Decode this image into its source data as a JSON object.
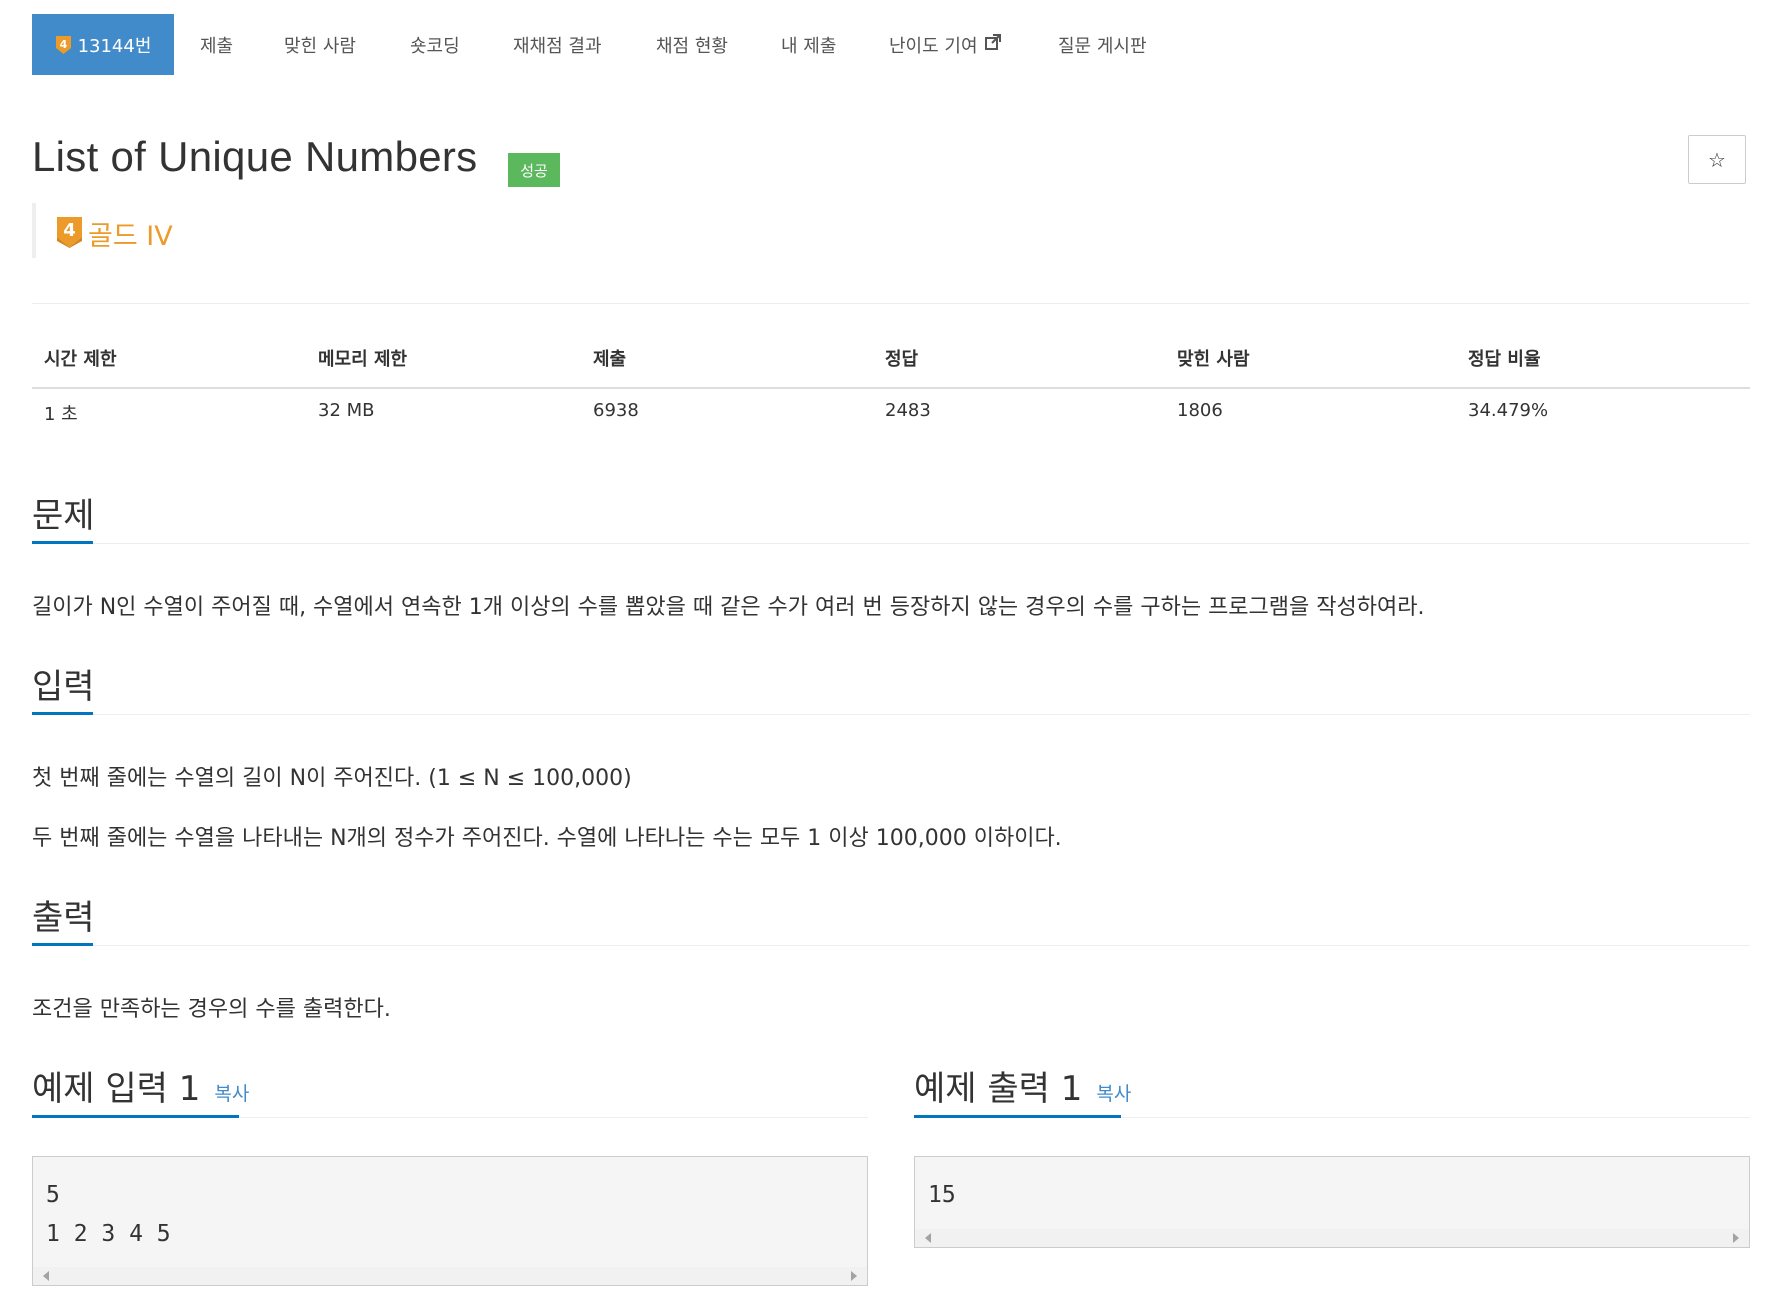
{
  "nav": {
    "active": {
      "tier": "4",
      "label": "13144번"
    },
    "items": [
      "제출",
      "맞힌 사람",
      "숏코딩",
      "재채점 결과",
      "채점 현황",
      "내 제출",
      "난이도 기여",
      "질문 게시판"
    ]
  },
  "problem": {
    "title": "List of Unique Numbers",
    "status_badge": "성공",
    "star": "☆",
    "tier_number": "4",
    "tier_label": "골드 IV"
  },
  "stats": {
    "headers": [
      "시간 제한",
      "메모리 제한",
      "제출",
      "정답",
      "맞힌 사람",
      "정답 비율"
    ],
    "values": [
      "1 초",
      "32 MB",
      "6938",
      "2483",
      "1806",
      "34.479%"
    ]
  },
  "sections": {
    "problem": {
      "title": "문제",
      "text": "길이가 N인 수열이 주어질 때, 수열에서 연속한 1개 이상의 수를 뽑았을 때 같은 수가 여러 번 등장하지 않는 경우의 수를 구하는 프로그램을 작성하여라."
    },
    "input": {
      "title": "입력",
      "line1": "첫 번째 줄에는 수열의 길이 N이 주어진다. (1 ≤ N ≤ 100,000)",
      "line2": "두 번째 줄에는 수열을 나타내는 N개의 정수가 주어진다. 수열에 나타나는 수는 모두 1 이상 100,000 이하이다."
    },
    "output": {
      "title": "출력",
      "text": "조건을 만족하는 경우의 수를 출력한다."
    }
  },
  "samples": {
    "input": {
      "title": "예제 입력 1",
      "copy": "복사",
      "line1": "5",
      "line2": "1 2 3 4 5"
    },
    "output": {
      "title": "예제 출력 1",
      "copy": "복사",
      "line1": "15"
    }
  },
  "colors": {
    "primary": "#428bca",
    "success": "#5cb85c",
    "gold": "#ec9a29",
    "section_underline": "#0076c0"
  }
}
